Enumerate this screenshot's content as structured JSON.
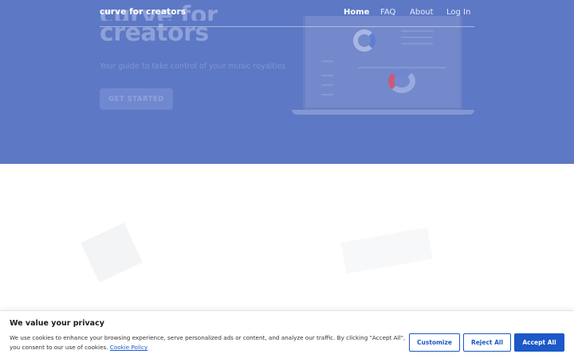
{
  "nav": {
    "logo": "curve for creators",
    "items": [
      {
        "label": "Home",
        "active": true
      },
      {
        "label": "FAQ",
        "active": false
      },
      {
        "label": "About",
        "active": false
      },
      {
        "label": "Log In",
        "active": false
      }
    ]
  },
  "hero": {
    "title_line1": "curve for",
    "title_line2": "creators",
    "subtitle": "Your guide to take control of your music royalties",
    "cta_label": "GET STARTED"
  },
  "cookie": {
    "title": "We value your privacy",
    "text": "We use cookies to enhance your browsing experience, serve personalized ads or content, and analyze our traffic. By clicking \"Accept All\", you consent to our use of cookies.",
    "link_label": "Cookie Policy",
    "customize_label": "Customize",
    "reject_label": "Reject All",
    "accept_label": "Accept All"
  },
  "colors": {
    "hero_bg": "#5d78c4",
    "button_primary": "#1c58c7",
    "link": "#1a5cd6"
  },
  "icons": [
    "laptop-illustration",
    "donut-chart-icon"
  ]
}
